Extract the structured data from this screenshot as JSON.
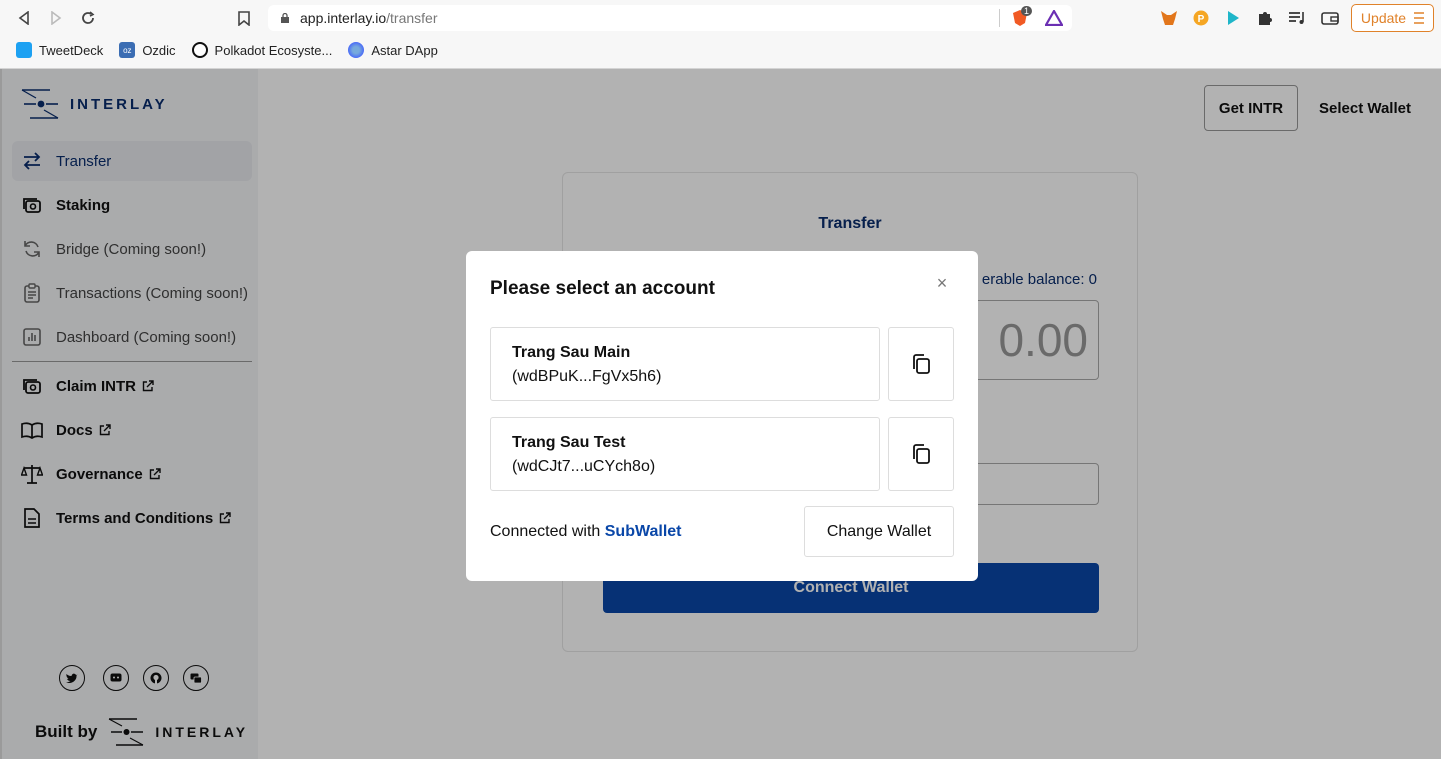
{
  "browser": {
    "url_host": "app.interlay.io",
    "url_path": "/transfer",
    "shield_badge": "1",
    "update_label": "Update",
    "bookmarks": [
      {
        "label": "TweetDeck",
        "icon": "twitter-icon",
        "color": "#1da1f2"
      },
      {
        "label": "Ozdic",
        "icon": "ozdic-icon",
        "color": "#3b6db3"
      },
      {
        "label": "Polkadot Ecosyste...",
        "icon": "polkadot-icon",
        "color": "#111111"
      },
      {
        "label": "Astar DApp",
        "icon": "astar-icon",
        "color": "#4a6cf7"
      }
    ]
  },
  "sidebar": {
    "logo_text": "INTERLAY",
    "items": [
      {
        "label": "Transfer",
        "icon": "transfer-arrows-icon",
        "active": true
      },
      {
        "label": "Staking",
        "icon": "staking-icon"
      },
      {
        "label": "Bridge (Coming soon!)",
        "icon": "bridge-icon"
      },
      {
        "label": "Transactions (Coming soon!)",
        "icon": "clipboard-icon"
      },
      {
        "label": "Dashboard (Coming soon!)",
        "icon": "chart-icon"
      },
      {
        "label": "Claim INTR",
        "icon": "claim-icon",
        "external": true
      },
      {
        "label": "Docs",
        "icon": "book-icon",
        "external": true
      },
      {
        "label": "Governance",
        "icon": "scales-icon",
        "external": true
      },
      {
        "label": "Terms and Conditions",
        "icon": "document-icon",
        "external": true
      }
    ],
    "social": [
      "twitter-icon",
      "discord-icon",
      "github-icon",
      "forum-icon"
    ],
    "built_by": "Built by",
    "built_by_brand": "INTERLAY"
  },
  "header": {
    "get_intr": "Get INTR",
    "select_wallet": "Select Wallet"
  },
  "transfer_card": {
    "title": "Transfer",
    "balance_label": "erable balance: 0",
    "amount": "0.00",
    "connect_label": "Connect Wallet"
  },
  "modal": {
    "title": "Please select an account",
    "accounts": [
      {
        "name": "Trang Sau Main",
        "address": "(wdBPuK...FgVx5h6)"
      },
      {
        "name": "Trang Sau Test",
        "address": "(wdCJt7...uCYch8o)"
      }
    ],
    "connected_prefix": "Connected with",
    "wallet_name": "SubWallet",
    "change_wallet": "Change Wallet"
  },
  "colors": {
    "brand": "#0a2d6e",
    "accent": "#0a47a8",
    "update": "#e0822a"
  }
}
